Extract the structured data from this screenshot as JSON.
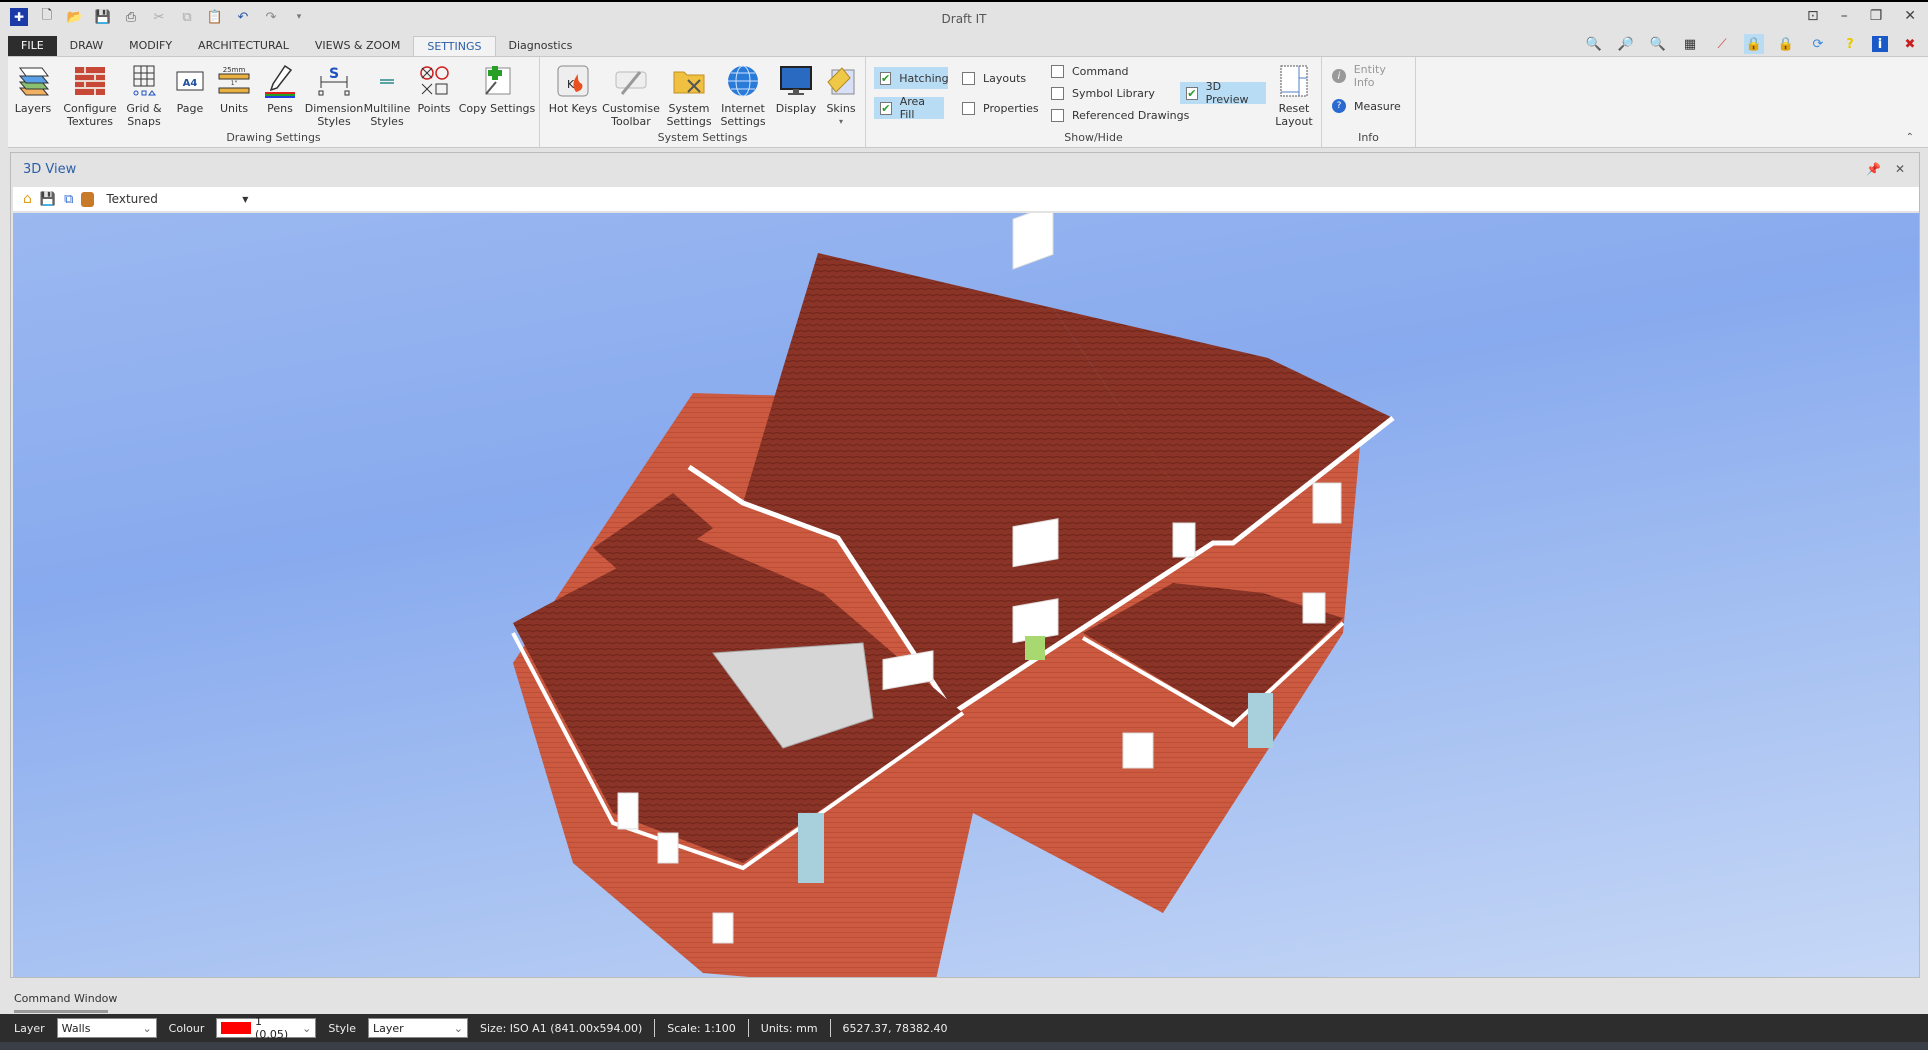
{
  "app": {
    "title": "Draft IT"
  },
  "quick_access": [
    "app-icon",
    "new-icon",
    "open-icon",
    "save-icon",
    "print-icon",
    "cut-icon",
    "copy-icon",
    "paste-icon",
    "undo-icon",
    "redo-icon",
    "customize-dropdown-icon"
  ],
  "tabs": [
    {
      "label": "FILE"
    },
    {
      "label": "DRAW"
    },
    {
      "label": "MODIFY"
    },
    {
      "label": "ARCHITECTURAL"
    },
    {
      "label": "VIEWS & ZOOM"
    },
    {
      "label": "SETTINGS",
      "active": true
    },
    {
      "label": "Diagnostics"
    }
  ],
  "ribbon": {
    "drawing_settings": {
      "label": "Drawing Settings",
      "buttons": [
        {
          "label": "Layers"
        },
        {
          "label": "Configure\nTextures"
        },
        {
          "label": "Grid &\nSnaps"
        },
        {
          "label": "Page"
        },
        {
          "label": "Units"
        },
        {
          "label": "Pens"
        },
        {
          "label": "Dimension\nStyles"
        },
        {
          "label": "Multiline\nStyles"
        },
        {
          "label": "Points"
        },
        {
          "label": "Copy Settings"
        }
      ]
    },
    "system_settings": {
      "label": "System Settings",
      "buttons": [
        {
          "label": "Hot Keys"
        },
        {
          "label": "Customise\nToolbar"
        },
        {
          "label": "System\nSettings"
        },
        {
          "label": "Internet\nSettings"
        },
        {
          "label": "Display"
        },
        {
          "label": "Skins"
        }
      ]
    },
    "show_hide": {
      "label": "Show/Hide",
      "hatching": {
        "label": "Hatching",
        "checked": true
      },
      "area_fill": {
        "label": "Area Fill",
        "checked": true
      },
      "layouts": {
        "label": "Layouts",
        "checked": false
      },
      "properties": {
        "label": "Properties",
        "checked": false
      },
      "command": {
        "label": "Command",
        "checked": false
      },
      "symbol_library": {
        "label": "Symbol Library",
        "checked": false
      },
      "referenced_drawings": {
        "label": "Referenced Drawings",
        "checked": false
      },
      "preview_3d": {
        "label": "3D Preview",
        "checked": true
      },
      "reset_layout": "Reset\nLayout"
    },
    "info": {
      "label": "Info",
      "entity_info": "Entity Info",
      "measure": "Measure"
    }
  },
  "view_panel": {
    "title": "3D View",
    "render_mode": "Textured"
  },
  "command_window": {
    "label": "Command Window"
  },
  "status": {
    "layer_label": "Layer",
    "layer_value": "Walls",
    "colour_label": "Colour",
    "colour_value": "1 (0.05)",
    "colour_swatch": "#ff0000",
    "style_label": "Style",
    "style_value": "Layer",
    "size": "Size: ISO A1 (841.00x594.00)",
    "scale": "Scale: 1:100",
    "units": "Units: mm",
    "coords": "6527.37, 78382.40"
  },
  "colors": {
    "accent": "#2b5ea8",
    "checked_bg": "#b9dcf5",
    "roof": "#8b3a2e",
    "brick": "#c8543a"
  }
}
